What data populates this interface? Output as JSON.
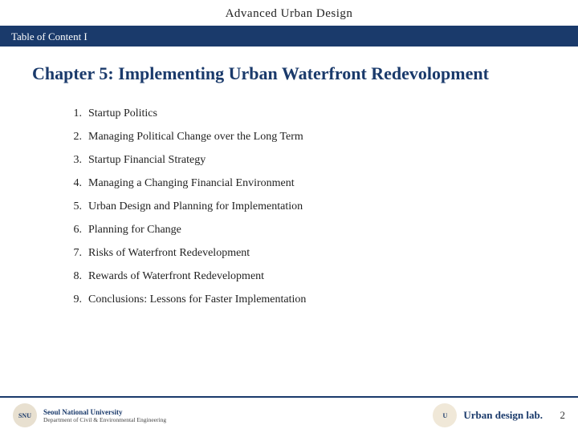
{
  "header": {
    "title": "Advanced Urban Design"
  },
  "toc": {
    "label": "Table of Content I"
  },
  "chapter": {
    "title": "Chapter 5: Implementing Urban Waterfront Redevolopment"
  },
  "list": {
    "items": [
      {
        "number": "1.",
        "text": "Startup Politics"
      },
      {
        "number": "2.",
        "text": "Managing Political Change over the Long Term"
      },
      {
        "number": "3.",
        "text": "Startup Financial Strategy"
      },
      {
        "number": "4.",
        "text": "Managing a Changing Financial Environment"
      },
      {
        "number": "5.",
        "text": "Urban Design and Planning for Implementation"
      },
      {
        "number": "6.",
        "text": "Planning for Change"
      },
      {
        "number": "7.",
        "text": "Risks of Waterfront Redevelopment"
      },
      {
        "number": "8.",
        "text": "Rewards of Waterfront Redevelopment"
      },
      {
        "number": "9.",
        "text": "Conclusions: Lessons for Faster Implementation"
      }
    ]
  },
  "footer": {
    "university_name": "Seoul National University",
    "department_name": "Department of Civil & Environmental Engineering",
    "udl_label": "Urban design lab.",
    "page_number": "2"
  }
}
